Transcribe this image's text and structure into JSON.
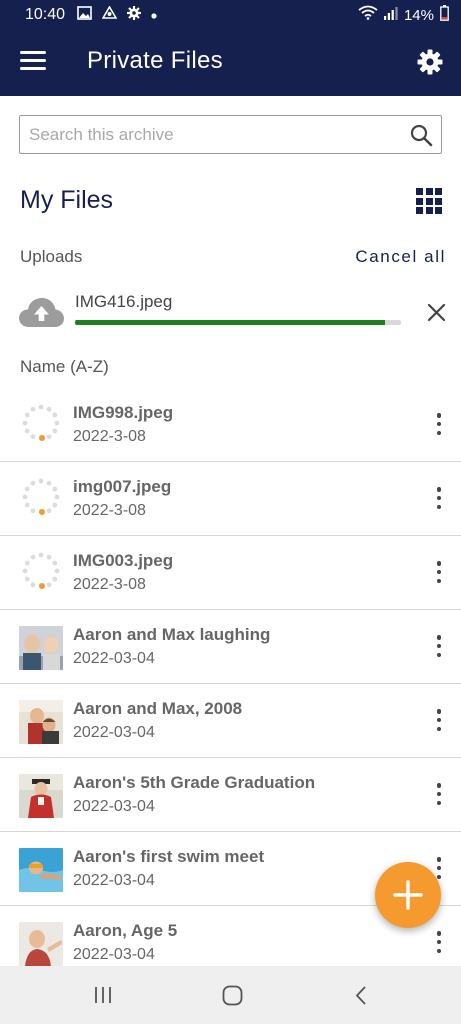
{
  "status_bar": {
    "time": "10:40",
    "battery": "14%"
  },
  "app_bar": {
    "title": "Private Files"
  },
  "search": {
    "placeholder": "Search this archive"
  },
  "heading": "My Files",
  "uploads": {
    "label": "Uploads",
    "cancel_all": "Cancel all",
    "item": {
      "name": "IMG416.jpeg",
      "progress": 0.95
    }
  },
  "sort_label": "Name (A-Z)",
  "files": [
    {
      "name": "IMG998.jpeg",
      "date": "2022-3-08",
      "thumb": "loading-spinner-icon"
    },
    {
      "name": "img007.jpeg",
      "date": "2022-3-08",
      "thumb": "loading-spinner-icon"
    },
    {
      "name": "IMG003.jpeg",
      "date": "2022-3-08",
      "thumb": "loading-spinner-icon"
    },
    {
      "name": "Aaron and Max laughing",
      "date": "2022-03-04",
      "thumb": "photo"
    },
    {
      "name": "Aaron and Max, 2008",
      "date": "2022-03-04",
      "thumb": "photo"
    },
    {
      "name": "Aaron's 5th Grade Graduation",
      "date": "2022-03-04",
      "thumb": "photo"
    },
    {
      "name": "Aaron's first swim meet",
      "date": "2022-03-04",
      "thumb": "photo"
    },
    {
      "name": "Aaron, Age 5",
      "date": "2022-03-04",
      "thumb": "photo"
    }
  ],
  "colors": {
    "header": "#16204f",
    "accent": "#f49a2e",
    "progress": "#1f7f1f"
  },
  "icons": [
    "menu-icon",
    "gear-icon",
    "search-icon",
    "grid-view-icon",
    "cloud-upload-icon",
    "close-icon",
    "more-vertical-icon",
    "plus-icon"
  ]
}
